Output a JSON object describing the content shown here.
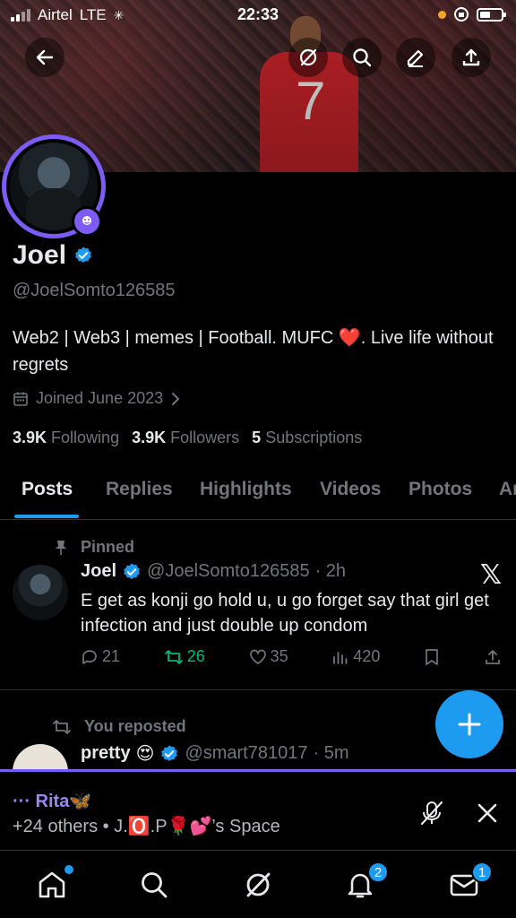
{
  "status_bar": {
    "carrier": "Airtel",
    "network": "LTE",
    "time": "22:33"
  },
  "profile": {
    "name": "Joel",
    "handle": "@JoelSomto126585",
    "bio": "Web2 | Web3 | memes | Football. MUFC ❤️. Live life without regrets",
    "joined": "Joined June 2023",
    "stats": [
      {
        "value": "3.9K",
        "label": "Following"
      },
      {
        "value": "3.9K",
        "label": "Followers"
      },
      {
        "value": "5",
        "label": "Subscriptions"
      }
    ]
  },
  "tabs": [
    "Posts",
    "Replies",
    "Highlights",
    "Videos",
    "Photos",
    "Ar"
  ],
  "active_tab": "Posts",
  "posts": [
    {
      "context": "Pinned",
      "name": "Joel",
      "handle": "@JoelSomto126585",
      "time": "· 2h",
      "text": "E get as konji go hold u, u go forget say that girl get infection and just double up condom",
      "replies": "21",
      "reposts": "26",
      "likes": "35",
      "views": "420"
    },
    {
      "context": "You reposted",
      "name": "pretty",
      "emoji": "😍",
      "handle": "@smart781017",
      "time": "· 5m"
    }
  ],
  "space": {
    "title": "··· Rita🦋",
    "subtitle": "+24 others • J.🅾️.P🌹💕’s Space"
  },
  "nav": {
    "notifications_badge": "2",
    "messages_badge": "1"
  },
  "colors": {
    "accent": "#1d9bf0",
    "space_purple": "#7c5cf5",
    "retweet_green": "#00ba7c",
    "muted": "#71767b"
  },
  "icons": [
    "back-arrow-icon",
    "grok-icon",
    "search-icon",
    "edit-icon",
    "share-icon",
    "calendar-icon",
    "chevron-right-icon",
    "pin-icon",
    "verified-badge-icon",
    "x-logo-icon",
    "reply-icon",
    "repost-icon",
    "like-icon",
    "views-icon",
    "bookmark-icon",
    "mic-off-icon",
    "close-icon",
    "home-icon",
    "bell-icon",
    "mail-icon",
    "plus-icon"
  ]
}
